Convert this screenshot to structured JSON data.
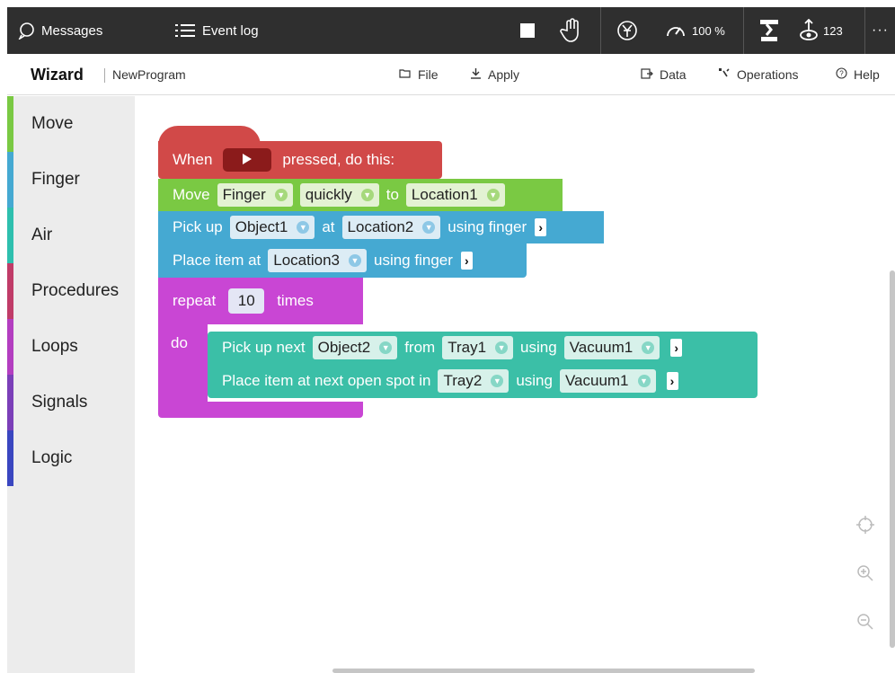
{
  "topbar": {
    "messages_label": "Messages",
    "eventlog_label": "Event log",
    "speed_label": "100 %",
    "counter_label": "123",
    "more_label": "···"
  },
  "subbar": {
    "title": "Wizard",
    "program_name": "NewProgram",
    "file_label": "File",
    "apply_label": "Apply",
    "data_label": "Data",
    "operations_label": "Operations",
    "help_label": "Help"
  },
  "sidebar": {
    "items": [
      {
        "label": "Move",
        "color": "#7ac943"
      },
      {
        "label": "Finger",
        "color": "#45a9d2"
      },
      {
        "label": "Air",
        "color": "#2ebfae"
      },
      {
        "label": "Procedures",
        "color": "#c03c68"
      },
      {
        "label": "Loops",
        "color": "#b33ec0"
      },
      {
        "label": "Signals",
        "color": "#7b3fb8"
      },
      {
        "label": "Logic",
        "color": "#3a46c0"
      }
    ]
  },
  "blocks": {
    "hat": {
      "when": "When",
      "pressed": "pressed, do this:"
    },
    "move": {
      "prefix": "Move",
      "target": "Finger",
      "speed": "quickly",
      "to": "to",
      "location": "Location1"
    },
    "pickup": {
      "prefix": "Pick up",
      "object": "Object1",
      "at": "at",
      "location": "Location2",
      "using": "using finger"
    },
    "place": {
      "prefix": "Place item at",
      "location": "Location3",
      "using": "using finger"
    },
    "repeat": {
      "prefix": "repeat",
      "count": "10",
      "times": "times",
      "do": "do"
    },
    "pickup_next": {
      "prefix": "Pick up next",
      "object": "Object2",
      "from": "from",
      "tray": "Tray1",
      "using": "using",
      "tool": "Vacuum1"
    },
    "place_next": {
      "prefix": "Place item at next open spot in",
      "tray": "Tray2",
      "using": "using",
      "tool": "Vacuum1"
    }
  },
  "colors": {
    "hat": "#d14948",
    "move": "#7ac943",
    "finger": "#45a9d2",
    "loops": "#c946d4",
    "air": "#3bbfa7"
  }
}
